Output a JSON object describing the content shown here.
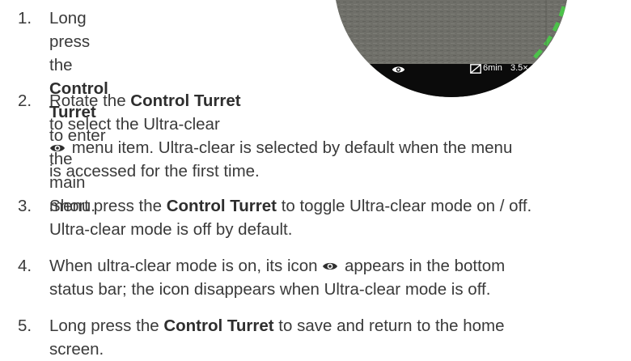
{
  "steps": [
    {
      "number": "1.",
      "lines": [
        {
          "pre": "Long press the ",
          "bold": "Control",
          "post": ""
        },
        {
          "pre": "",
          "bold": "Turret",
          "post": " to enter the main"
        },
        {
          "pre": "menu.",
          "bold": "",
          "post": ""
        }
      ]
    },
    {
      "number": "2.",
      "lines": [
        {
          "pre": "Rotate the ",
          "bold": "Control Turret",
          "post": ""
        },
        {
          "pre": "to select the Ultra-clear",
          "bold": "",
          "post": ""
        },
        {
          "pre": "",
          "bold": "",
          "post": " menu item. Ultra-clear is selected by default when the menu"
        },
        {
          "pre": "is accessed for the first time.",
          "bold": "",
          "post": ""
        }
      ]
    },
    {
      "number": "3.",
      "lines": [
        {
          "pre": "Short press the ",
          "bold": "Control Turret",
          "post": " to toggle Ultra-clear mode on / off."
        },
        {
          "pre": "Ultra-clear mode is off by default.",
          "bold": "",
          "post": ""
        }
      ]
    },
    {
      "number": "4.",
      "lines": [
        {
          "pre": "When ultra-clear mode is on, its icon ",
          "bold": "",
          "post": " appears in the bottom"
        },
        {
          "pre": "status bar; the icon disappears when Ultra-clear mode is off.",
          "bold": "",
          "post": ""
        }
      ]
    },
    {
      "number": "5.",
      "lines": [
        {
          "pre": "Long press the ",
          "bold": "Control Turret",
          "post": " to save and return to the home"
        },
        {
          "pre": "screen.",
          "bold": "",
          "post": ""
        }
      ]
    }
  ],
  "scope_status": {
    "time": "6min",
    "zoom": "3.5×"
  },
  "icons": {
    "ultra_clear": "eye-icon",
    "battery": "battery-icon"
  },
  "colors": {
    "text": "#3a3a3a",
    "bold_text": "#2e2e2e",
    "status_bar": "#0b0b0b",
    "reticle_arc": "#4cc24a"
  }
}
